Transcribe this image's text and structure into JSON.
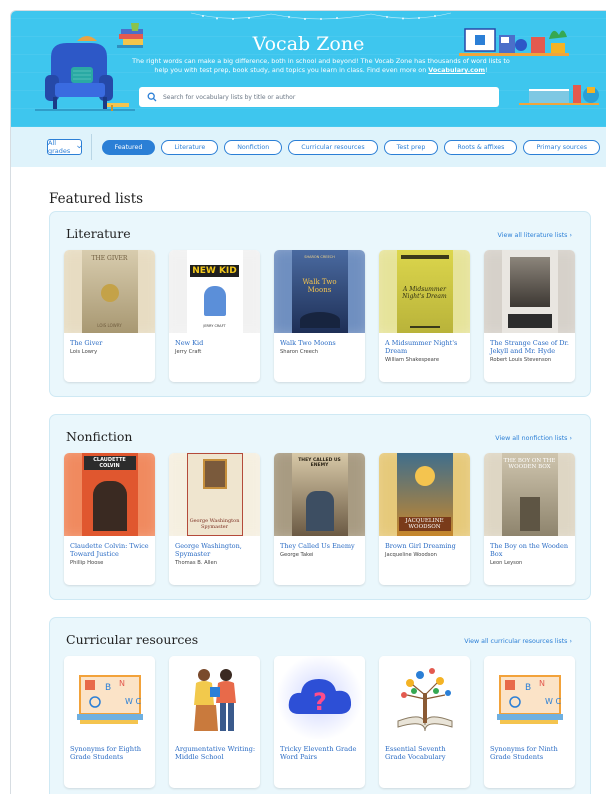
{
  "hero": {
    "title": "Vocab Zone",
    "description_main": "The right words can make a big difference, both in school and beyond! The Vocab Zone has thousands of word lists to help you with test prep, book study, and topics you learn in class. Find even more on ",
    "description_link": "Vocabulary.com",
    "description_end": "!",
    "search_placeholder": "Search for vocabulary lists by title or author"
  },
  "filters": {
    "grade_label": "All grades",
    "chips": [
      "Featured",
      "Literature",
      "Nonfiction",
      "Curricular resources",
      "Test prep",
      "Roots & affixes",
      "Primary sources"
    ]
  },
  "page_heading": "Featured lists",
  "sections": {
    "literature": {
      "title": "Literature",
      "link": "View all literature lists",
      "items": [
        {
          "title": "The Giver",
          "author": "Lois Lowry",
          "cover_text": "THE GIVER",
          "cover_sub": "LOIS LOWRY",
          "color": "#cdbf9d"
        },
        {
          "title": "New Kid",
          "author": "Jerry Craft",
          "cover_text": "NEW KID",
          "cover_sub": "JERRY CRAFT",
          "color": "#ffffff"
        },
        {
          "title": "Walk Two Moons",
          "author": "Sharon Creech",
          "cover_text": "Walk Two Moons",
          "cover_sub": "SHARON CREECH",
          "color": "#2b4774"
        },
        {
          "title": "A Midsummer Night's Dream",
          "author": "William Shakespeare",
          "cover_text": "A Midsummer Night's Dream",
          "cover_sub": "",
          "color": "#d7d24a"
        },
        {
          "title": "The Strange Case of Dr. Jekyll and Mr. Hyde",
          "author": "Robert Louis Stevenson",
          "cover_text": "",
          "cover_sub": "",
          "color": "#c9c3bb"
        }
      ]
    },
    "nonfiction": {
      "title": "Nonfiction",
      "link": "View all nonfiction lists",
      "items": [
        {
          "title": "Claudette Colvin: Twice Toward Justice",
          "author": "Phillip Hoose",
          "cover_text": "CLAUDETTE COLVIN",
          "cover_sub": "",
          "color": "#e0572f"
        },
        {
          "title": "George Washington, Spymaster",
          "author": "Thomas B. Allen",
          "cover_text": "George Washington Spymaster",
          "cover_sub": "",
          "color": "#efe5cf"
        },
        {
          "title": "They Called Us Enemy",
          "author": "George Takei",
          "cover_text": "THEY CALLED US ENEMY",
          "cover_sub": "",
          "color": "#8a7b63"
        },
        {
          "title": "Brown Girl Dreaming",
          "author": "Jacqueline Woodson",
          "cover_text": "JACQUELINE WOODSON",
          "cover_sub": "",
          "color": "#3f6e8c"
        },
        {
          "title": "The Boy on the Wooden Box",
          "author": "Leon Leyson",
          "cover_text": "THE BOY ON THE WOODEN BOX",
          "cover_sub": "",
          "color": "#b8ad93"
        }
      ]
    },
    "curricular": {
      "title": "Curricular resources",
      "link": "View all curricular resources lists",
      "items": [
        {
          "title": "Synonyms for Eighth Grade Students",
          "author": ""
        },
        {
          "title": "Argumentative Writing: Middle School",
          "author": ""
        },
        {
          "title": "Tricky Eleventh Grade Word Pairs",
          "author": ""
        },
        {
          "title": "Essential Seventh Grade Vocabulary",
          "author": ""
        },
        {
          "title": "Synonyms for Ninth Grade Students",
          "author": ""
        }
      ]
    }
  },
  "colors": {
    "hero_bg": "#3ec6ee",
    "accent": "#2b7fd6",
    "section_bg": "#eaf7fc",
    "filter_bg": "#dff3fb"
  }
}
